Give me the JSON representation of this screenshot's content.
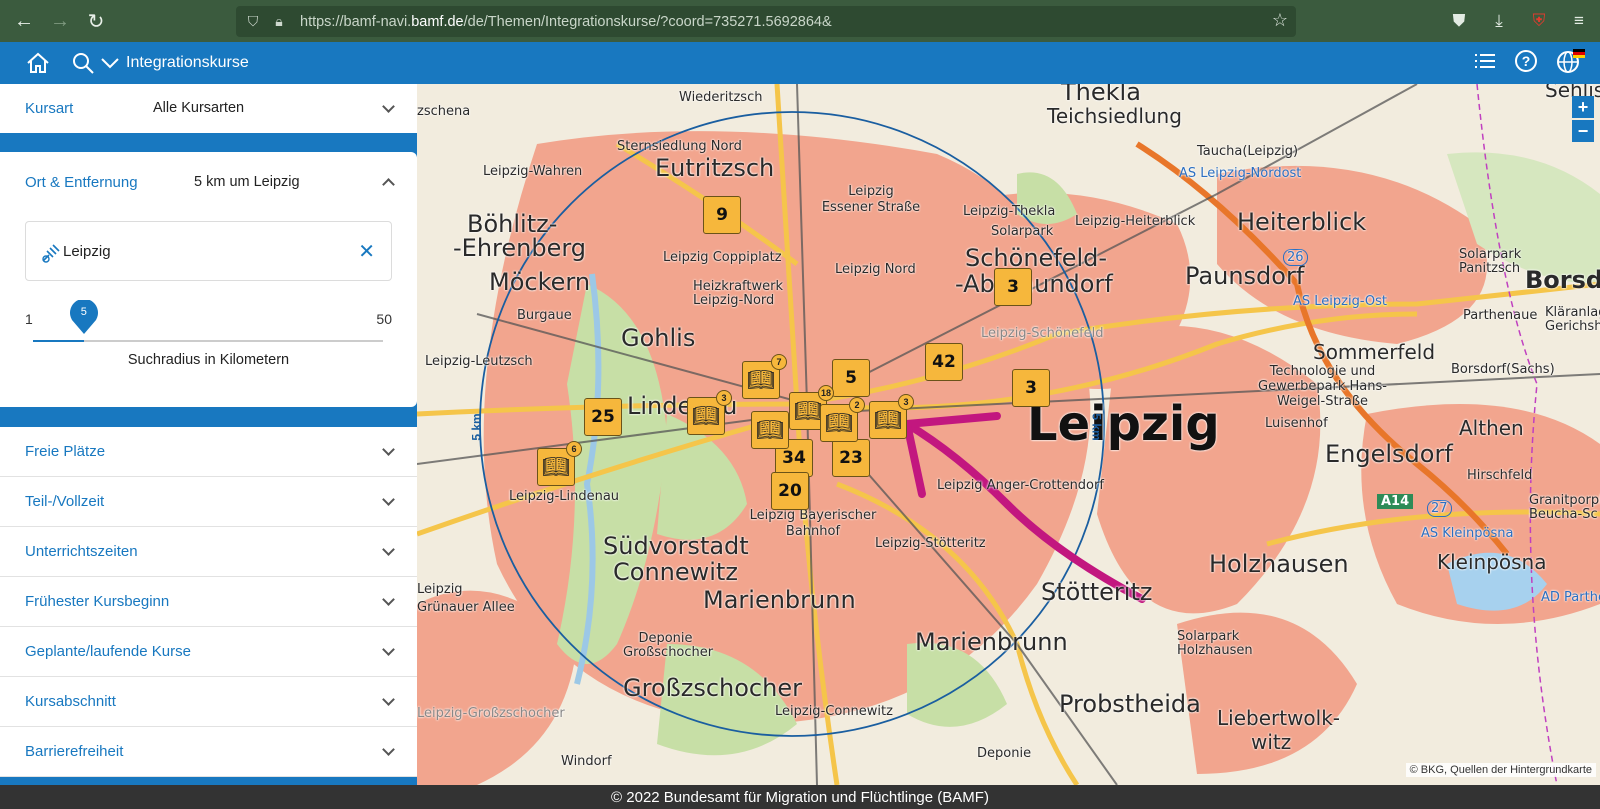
{
  "browser": {
    "url_prefix": "https://bamf-navi.",
    "url_domain": "bamf.de",
    "url_rest": "/de/Themen/Integrationskurse/?coord=735271.5692864&"
  },
  "header": {
    "title": "Integrationskurse"
  },
  "sidebar": {
    "kursart": {
      "label": "Kursart",
      "value": "Alle Kursarten"
    },
    "ort": {
      "label": "Ort & Entfernung",
      "value": "5 km um Leipzig",
      "location_value": "Leipzig",
      "slider_min": "1",
      "slider_max": "50",
      "slider_value": "5",
      "slider_fraction": 0.0816,
      "slider_caption": "Suchradius in Kilometern"
    },
    "filters": [
      {
        "label": "Freie Plätze"
      },
      {
        "label": "Teil-/Vollzeit"
      },
      {
        "label": "Unterrichtszeiten"
      },
      {
        "label": "Frühester Kursbeginn"
      },
      {
        "label": "Geplante/laufende Kurse"
      },
      {
        "label": "Kursabschnitt"
      },
      {
        "label": "Barrierefreiheit"
      }
    ]
  },
  "map": {
    "places": [
      "Wiederitzsch",
      "Eutritzsch",
      "Sternsiedlung Nord",
      "Leipzig-Wahren",
      "Böhlitz-",
      "-Ehrenberg",
      "Möckern",
      "Burgaue",
      "Gohlis",
      "Leipzig Coppiplatz",
      "Heizkraftwerk Leipzig-Nord",
      "Leipzig Essener Straße",
      "Leipzig Nord",
      "Schönefeld-",
      "-Abtnaundorf",
      "Leipzig-Thekla",
      "Solarpark",
      "Thekla",
      "Teichsiedlung",
      "Taucha(Leipzig)",
      "AS Leipzig-Nordost",
      "Leipzig-Heiterblick",
      "Heiterblick",
      "Paunsdorf",
      "Solarpark Panitzsch",
      "Borsdorf",
      "AS Leipzig-Ost",
      "Parthenaue",
      "Kläranlage Gerichshain",
      "Sehlis",
      "Sommerfeld",
      "Technologie und Gewerbepark Hans-Weigel-Straße",
      "Borsdorf(Sachs)",
      "Leipzig",
      "Luisenhof",
      "Althen",
      "Engelsdorf",
      "Hirschfeld",
      "Granitporphyr Beucha-Sc",
      "AS Kleinpösna",
      "Kleinpösna",
      "AD Parthe",
      "Holzhausen",
      "Solarpark Holzhausen",
      "Stötteritz",
      "Leipzig-Stötteritz",
      "Leipzig Anger-Crottendorf",
      "Leipzig-Schönefeld",
      "Leipzig-Leutzsch",
      "Lindenau",
      "Leipzig-Lindenau",
      "Leipzig Grünauer Allee",
      "Südvorstadt",
      "Connewitz",
      "Marienbrunn",
      "Leipzig Bayerischer Bahnhof",
      "Deponie Großschocher",
      "Großzschocher",
      "Leipzig-Großzschocher",
      "Windorf",
      "Leipzig-Connewitz",
      "Probstheida",
      "Liebertwolk-",
      "witz",
      "Deponie",
      "Leipzig-Connewitz",
      "Marienbrunn",
      "zschena",
      "A14",
      "26",
      "27"
    ],
    "radius_label": "5 km",
    "clusters": [
      "9",
      "3",
      "42",
      "5",
      "3",
      "25",
      "34",
      "20",
      "23"
    ],
    "book_counts": [
      "7",
      "18",
      "2",
      "3",
      "3",
      "6"
    ],
    "attribution": "© BKG, Quellen der Hintergrundkarte"
  },
  "footer": {
    "text": "© 2022 Bundesamt für Migration und Flüchtlinge (BAMF)"
  },
  "colors": {
    "brand": "#1878c0",
    "cluster": "#f6b73c",
    "arrow": "#c2177f",
    "footer": "#333333"
  },
  "icons": [
    "back-icon",
    "forward-icon",
    "reload-icon",
    "shield-icon",
    "lock-icon",
    "star-icon",
    "pocket-icon",
    "download-icon",
    "extension-icon",
    "menu-icon",
    "home-icon",
    "search-icon",
    "chevron-down-icon",
    "list-icon",
    "help-icon",
    "language-icon",
    "location-icon",
    "close-icon",
    "book-icon",
    "zoom-in-icon",
    "zoom-out-icon"
  ]
}
